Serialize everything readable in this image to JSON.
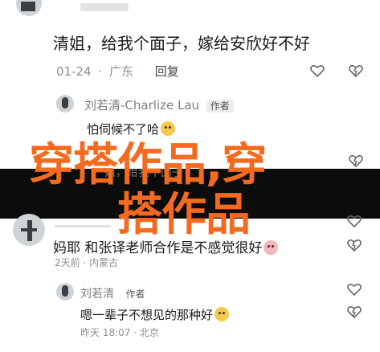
{
  "comments": [
    {
      "text": "清姐，给我个面子，嫁给安欣好不好",
      "date": "01-24",
      "separator": "·",
      "location": "广东",
      "reply_label": "回复"
    }
  ],
  "reply1": {
    "author": "刘若清-Charlize Lau",
    "badge": "作者",
    "text": "怕伺候不了哈",
    "tail_text": "姐，给我个面子"
  },
  "comment2": {
    "text": "妈耶 和张译老师合作是不感觉很好",
    "meta": "2天前 · 内蒙古"
  },
  "reply2": {
    "author": "刘若清",
    "badge": "作者",
    "text": "嗯一辈子不想见的那种好",
    "meta": "昨天 18:07 · 北京"
  },
  "overlay": {
    "line1": "穿搭作品,穿",
    "line2": "搭作品",
    "color": "#f46a1e"
  },
  "icons": [
    "heart-outline-icon",
    "heart-dislike-icon",
    "avatar"
  ]
}
